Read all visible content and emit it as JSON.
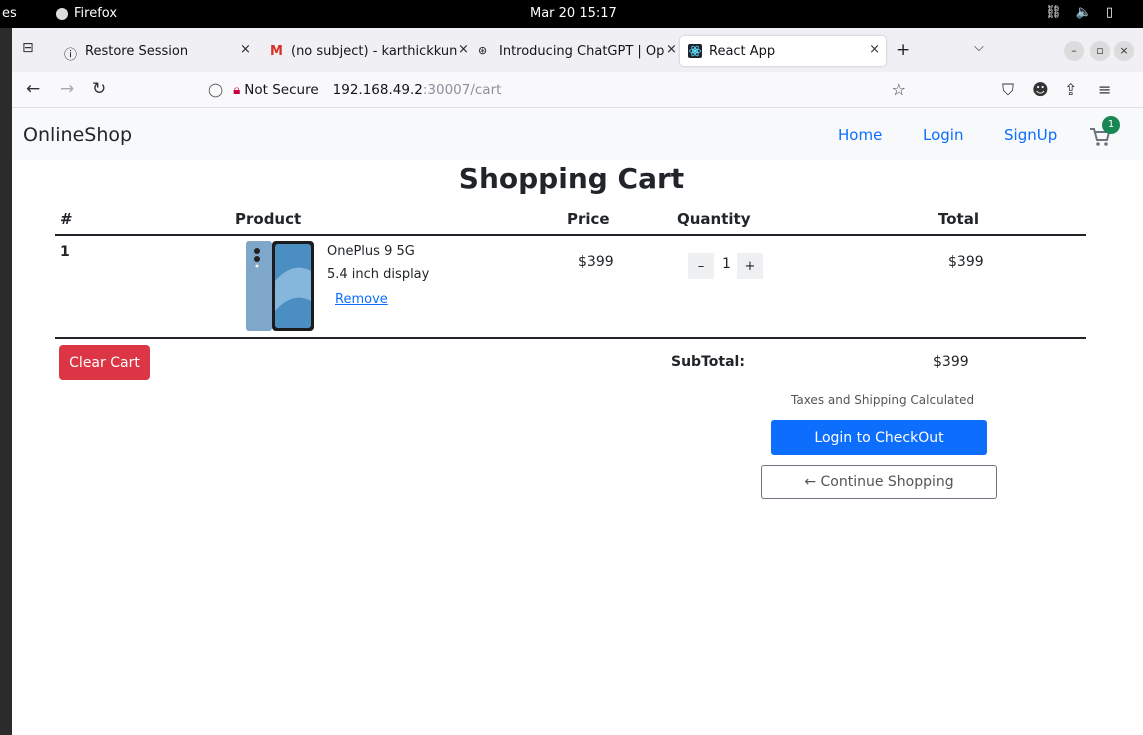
{
  "desktop": {
    "activities": "es",
    "app_name": "Firefox",
    "clock": "Mar 20  15:17"
  },
  "browser": {
    "tabs": [
      {
        "label": "Restore Session",
        "icon": "info-icon"
      },
      {
        "label": "(no subject) - karthickkun",
        "icon": "gmail-icon"
      },
      {
        "label": "Introducing ChatGPT | Op",
        "icon": "openai-icon"
      },
      {
        "label": "React App",
        "icon": "react-icon",
        "active": true
      }
    ],
    "url": {
      "security_label": "Not Secure",
      "host": "192.168.49.2",
      "path": ":30007/cart"
    }
  },
  "site": {
    "brand": "OnlineShop",
    "nav": {
      "home": "Home",
      "login": "Login",
      "signup": "SignUp"
    },
    "cart_count": "1",
    "accent_color": "#0d6efd"
  },
  "cart": {
    "title": "Shopping Cart",
    "headers": {
      "index": "#",
      "product": "Product",
      "price": "Price",
      "quantity": "Quantity",
      "total": "Total"
    },
    "items": [
      {
        "index": "1",
        "name": "OnePlus 9 5G",
        "desc": "5.4 inch display",
        "remove_label": "Remove",
        "price": "$399",
        "qty_minus": "–",
        "qty": "1",
        "qty_plus": "+",
        "total": "$399"
      }
    ],
    "clear_label": "Clear Cart",
    "subtotal_label": "SubTotal:",
    "subtotal": "$399",
    "taxes_note": "Taxes and Shipping Calculated",
    "checkout_label": "Login to CheckOut",
    "continue_label": "← Continue Shopping"
  }
}
